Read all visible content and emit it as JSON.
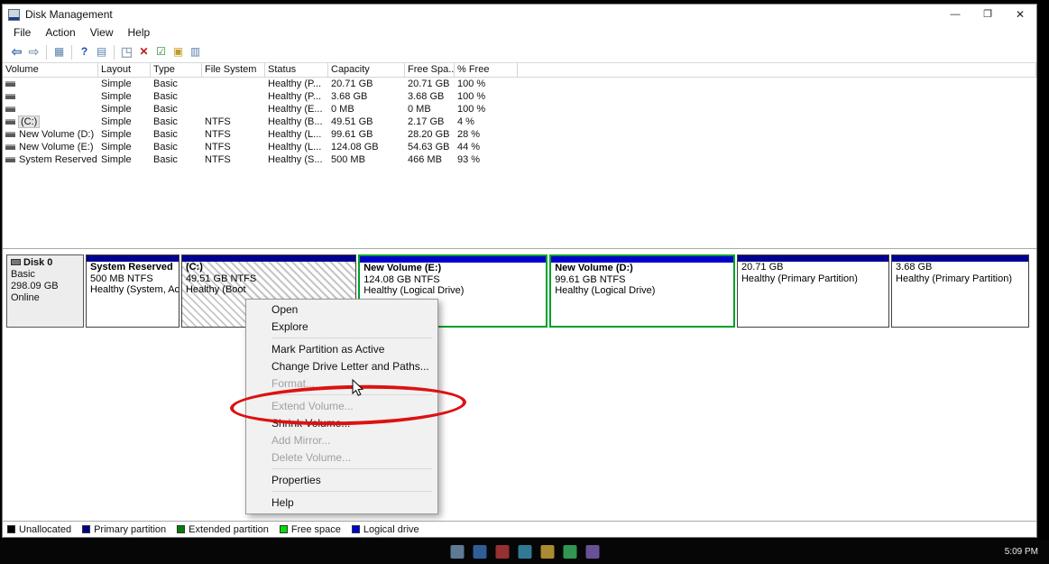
{
  "titlebar": {
    "title": "Disk Management",
    "minimize_label": "—",
    "maximize_label": "❐",
    "close_label": "✕"
  },
  "menubar": {
    "file": "File",
    "action": "Action",
    "view": "View",
    "help": "Help"
  },
  "toolbar": {
    "icons": [
      {
        "name": "back-icon",
        "glyph": "⇦"
      },
      {
        "name": "forward-icon",
        "glyph": "⇨"
      },
      {
        "name": "show-console-tree-icon",
        "glyph": "▦"
      },
      {
        "name": "help-icon",
        "glyph": "?"
      },
      {
        "name": "show-action-pane-icon",
        "glyph": "▤"
      },
      {
        "name": "refresh-icon",
        "glyph": "◳"
      },
      {
        "name": "delete-volume-icon",
        "glyph": "✕"
      },
      {
        "name": "mark-active-icon",
        "glyph": "☑"
      },
      {
        "name": "open-folder-icon",
        "glyph": "▣"
      },
      {
        "name": "properties-icon",
        "glyph": "▥"
      }
    ]
  },
  "volume_list": {
    "columns": [
      "Volume",
      "Layout",
      "Type",
      "File System",
      "Status",
      "Capacity",
      "Free Spa...",
      "% Free"
    ],
    "rows": [
      {
        "volume": "",
        "layout": "Simple",
        "type": "Basic",
        "file_system": "",
        "status": "Healthy (P...",
        "capacity": "20.71 GB",
        "free_space": "20.71 GB",
        "pct_free": "100 %"
      },
      {
        "volume": "",
        "layout": "Simple",
        "type": "Basic",
        "file_system": "",
        "status": "Healthy (P...",
        "capacity": "3.68 GB",
        "free_space": "3.68 GB",
        "pct_free": "100 %"
      },
      {
        "volume": "",
        "layout": "Simple",
        "type": "Basic",
        "file_system": "",
        "status": "Healthy (E...",
        "capacity": "0 MB",
        "free_space": "0 MB",
        "pct_free": "100 %"
      },
      {
        "volume": "(C:)",
        "layout": "Simple",
        "type": "Basic",
        "file_system": "NTFS",
        "status": "Healthy (B...",
        "capacity": "49.51 GB",
        "free_space": "2.17 GB",
        "pct_free": "4 %"
      },
      {
        "volume": "New Volume (D:)",
        "layout": "Simple",
        "type": "Basic",
        "file_system": "NTFS",
        "status": "Healthy (L...",
        "capacity": "99.61 GB",
        "free_space": "28.20 GB",
        "pct_free": "28 %"
      },
      {
        "volume": "New Volume (E:)",
        "layout": "Simple",
        "type": "Basic",
        "file_system": "NTFS",
        "status": "Healthy (L...",
        "capacity": "124.08 GB",
        "free_space": "54.63 GB",
        "pct_free": "44 %"
      },
      {
        "volume": "System Reserved",
        "layout": "Simple",
        "type": "Basic",
        "file_system": "NTFS",
        "status": "Healthy (S...",
        "capacity": "500 MB",
        "free_space": "466 MB",
        "pct_free": "93 %"
      }
    ]
  },
  "disk0": {
    "name": "Disk 0",
    "type": "Basic",
    "size": "298.09 GB",
    "status": "Online",
    "partitions": [
      {
        "kind": "primary",
        "lines": [
          "System Reserved",
          "500 MB NTFS",
          "Healthy (System, Activ"
        ]
      },
      {
        "kind": "primary",
        "selected": true,
        "lines": [
          "(C:)",
          "49.51 GB NTFS",
          "Healthy (Boot"
        ]
      },
      {
        "kind": "logical",
        "lines": [
          "New Volume (E:)",
          "124.08 GB NTFS",
          "Healthy (Logical Drive)"
        ]
      },
      {
        "kind": "logical",
        "lines": [
          "New Volume (D:)",
          "99.61 GB NTFS",
          "Healthy (Logical Drive)"
        ]
      },
      {
        "kind": "primary",
        "lines": [
          "",
          "20.71 GB",
          "Healthy (Primary Partition)"
        ]
      },
      {
        "kind": "primary",
        "lines": [
          "",
          "3.68 GB",
          "Healthy (Primary Partition)"
        ]
      }
    ]
  },
  "context_menu": {
    "items": [
      {
        "label": "Open",
        "enabled": true
      },
      {
        "label": "Explore",
        "enabled": true
      },
      {
        "separator": true
      },
      {
        "label": "Mark Partition as Active",
        "enabled": true
      },
      {
        "label": "Change Drive Letter and Paths...",
        "enabled": true
      },
      {
        "label": "Format...",
        "enabled": false
      },
      {
        "separator": true
      },
      {
        "label": "Extend Volume...",
        "enabled": false
      },
      {
        "label": "Shrink Volume...",
        "enabled": true
      },
      {
        "label": "Add Mirror...",
        "enabled": false
      },
      {
        "label": "Delete Volume...",
        "enabled": false
      },
      {
        "separator": true
      },
      {
        "label": "Properties",
        "enabled": true
      },
      {
        "separator": true
      },
      {
        "label": "Help",
        "enabled": true
      }
    ]
  },
  "legend": {
    "items": [
      {
        "label": "Unallocated",
        "color": "#000000"
      },
      {
        "label": "Primary partition",
        "color": "#00008b"
      },
      {
        "label": "Extended partition",
        "color": "#008000"
      },
      {
        "label": "Free space",
        "color": "#00dd00"
      },
      {
        "label": "Logical drive",
        "color": "#0000d2"
      }
    ]
  },
  "annotation": {
    "type": "ellipse",
    "color": "#dd1111"
  },
  "taskbar": {
    "time": "5:09 PM"
  }
}
